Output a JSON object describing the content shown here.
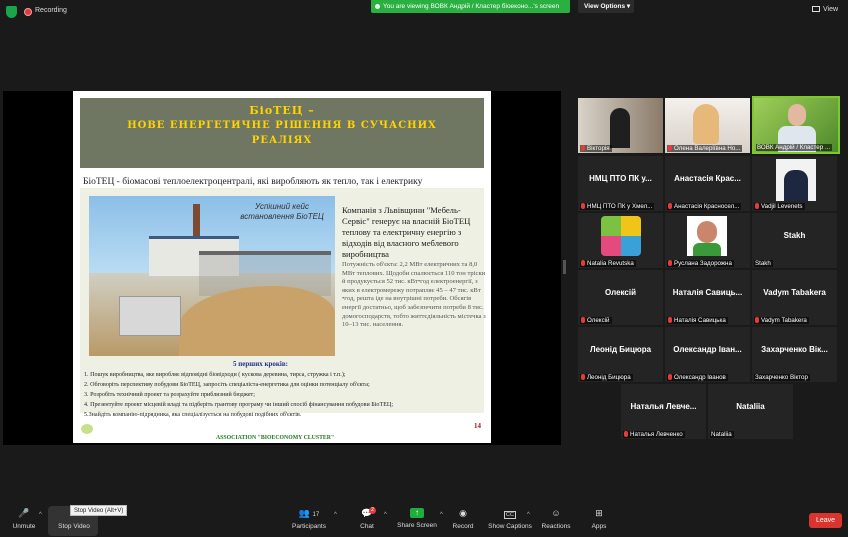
{
  "top_bar": {
    "recording_label": "Recording",
    "viewing_text": "You are viewing ВОВК Андрій / Кластер біоеконо...'s screen",
    "view_options": "View Options ▾",
    "view_label": "View"
  },
  "slide": {
    "title_line1": "БіоТЕЦ –",
    "title_line2": "НОВЕ ЕНЕРГЕТИЧНЕ РІШЕННЯ В СУЧАСНИХ",
    "title_line3": "РЕАЛІЯХ",
    "subtitle": "БіоТЕЦ - біомасові теплоелектроцентралі, які виробляють як тепло, так і електрику",
    "photo_caption": "Успішний кейс встановлення БіоТЕЦ",
    "company_text": "Компанія з Львівщини \"Мебель-Сервіс\" генерує на власній БіоТЕЦ теплову та електричну енергію з відходів від власного меблевого виробництва",
    "power_text": "Потужність об'єкта: 2,2 МВт електричних та 8,0 МВт теплових. Щодоби спалюється 110 тон тріски й продукується 52 тис. кВт•год електроенергії, з яких в електромережу потрапляє 45 – 47 тис. кВт •год, решта іде на внутрішні потреби. Обсягів енергії достатньо, щоб забезпечити потреби 8 тис. домогосподарств, тобто життєдіяльність містечка з 10–13 тис. населення.",
    "steps_title": "5 перших кроків:",
    "steps": [
      "1. Пошук виробництва, яке виробляє відповідні біовідходи ( кускова деревина, тирса, стружка і т.п.);",
      "2. Обговоріть перспективу побудови БіоТЕЦ, запросіть спеціаліста-енергетика для оцінки потенціалу об'єкта;",
      "3. Розробіть технічний проект та розрахуйте приблизний бюджет;",
      "4. Презентуйте проект місцевій владі та підберіть грантову програму чи інший спосіб фінансування побудови БіоТЕЦ;",
      "5.Знайдіть компанію-підрядника, яка спеціалізується на побудові подібних об'єктів."
    ],
    "slide_number": "14",
    "association": "ASSOCIATION \"BIOECONOMY CLUSTER\""
  },
  "participants": [
    {
      "name": "Вікторія",
      "big": "",
      "photo": true,
      "muted": true
    },
    {
      "name": "Олена Валеріївна Но...",
      "big": "",
      "photo": true,
      "muted": true
    },
    {
      "name": "ВОВК Андрій / Кластер ...",
      "big": "",
      "photo": true,
      "muted": false,
      "active": true
    },
    {
      "name": "НМЦ ПТО ПК у Хмел...",
      "big": "НМЦ ПТО ПК у...",
      "photo": false,
      "muted": true
    },
    {
      "name": "Анастасія Красносел...",
      "big": "Анастасія Крас...",
      "photo": false,
      "muted": true
    },
    {
      "name": "Vadjil Levenets",
      "big": "",
      "photo": true,
      "muted": true
    },
    {
      "name": "Natalia Revutska",
      "big": "",
      "photo": true,
      "muted": true
    },
    {
      "name": "Руслана Задорожна",
      "big": "",
      "photo": true,
      "muted": true
    },
    {
      "name": "Stakh",
      "big": "Stakh",
      "photo": false,
      "muted": false
    },
    {
      "name": "Олексій",
      "big": "Олексій",
      "photo": false,
      "muted": true
    },
    {
      "name": "Наталія Савицька",
      "big": "Наталія Савиць...",
      "photo": false,
      "muted": true
    },
    {
      "name": "Vadym Tabakera",
      "big": "Vadym Tabakera",
      "photo": false,
      "muted": true
    },
    {
      "name": "Леонід Бицюра",
      "big": "Леонід Бицюра",
      "photo": false,
      "muted": true
    },
    {
      "name": "Олександр Іванов",
      "big": "Олександр Іван...",
      "photo": false,
      "muted": true
    },
    {
      "name": "Захарченко Віктор",
      "big": "Захарченко Вік...",
      "photo": false,
      "muted": false
    },
    {
      "name": "Наталья Левченко",
      "big": "Наталья Левче...",
      "photo": false,
      "muted": true
    },
    {
      "name": "Nataliia",
      "big": "Nataliia",
      "photo": false,
      "muted": false
    }
  ],
  "toolbar": {
    "unmute": "Unmute",
    "stop_video": "Stop Video",
    "tooltip": "Stop Video (Alt+V)",
    "participants": "Participants",
    "participants_count": "17",
    "chat": "Chat",
    "chat_badge": "2",
    "share_screen": "Share Screen",
    "record": "Record",
    "show_captions": "Show Captions",
    "captions_icon": "CC",
    "reactions": "Reactions",
    "apps": "Apps",
    "leave": "Leave"
  },
  "colors": {
    "viewing_green": "#29b040",
    "active_speaker": "#7ec829",
    "slide_title_yellow": "#ffd400",
    "leave_red": "#d7352e"
  }
}
